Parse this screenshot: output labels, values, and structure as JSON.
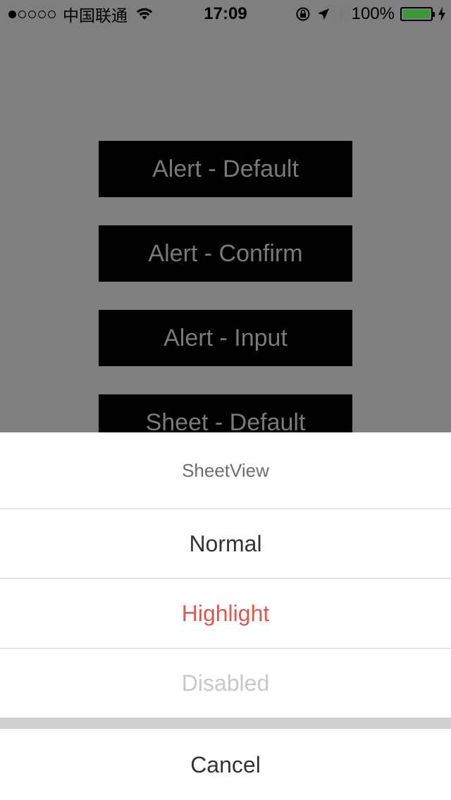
{
  "status_bar": {
    "carrier": "中国联通",
    "time": "17:09",
    "battery": "100%",
    "signal_bars": 1,
    "battery_level": 1.0
  },
  "buttons": [
    {
      "label": "Alert - Default"
    },
    {
      "label": "Alert - Confirm"
    },
    {
      "label": "Alert - Input"
    },
    {
      "label": "Sheet - Default"
    }
  ],
  "sheet": {
    "title": "SheetView",
    "items": [
      {
        "label": "Normal",
        "state": "normal"
      },
      {
        "label": "Highlight",
        "state": "highlight"
      },
      {
        "label": "Disabled",
        "state": "disabled"
      }
    ],
    "cancel": "Cancel"
  },
  "colors": {
    "dim_background": "#7f7f7f",
    "highlight": "#e0574f",
    "disabled": "#c8c8c8",
    "battery": "#3a9a3a"
  }
}
